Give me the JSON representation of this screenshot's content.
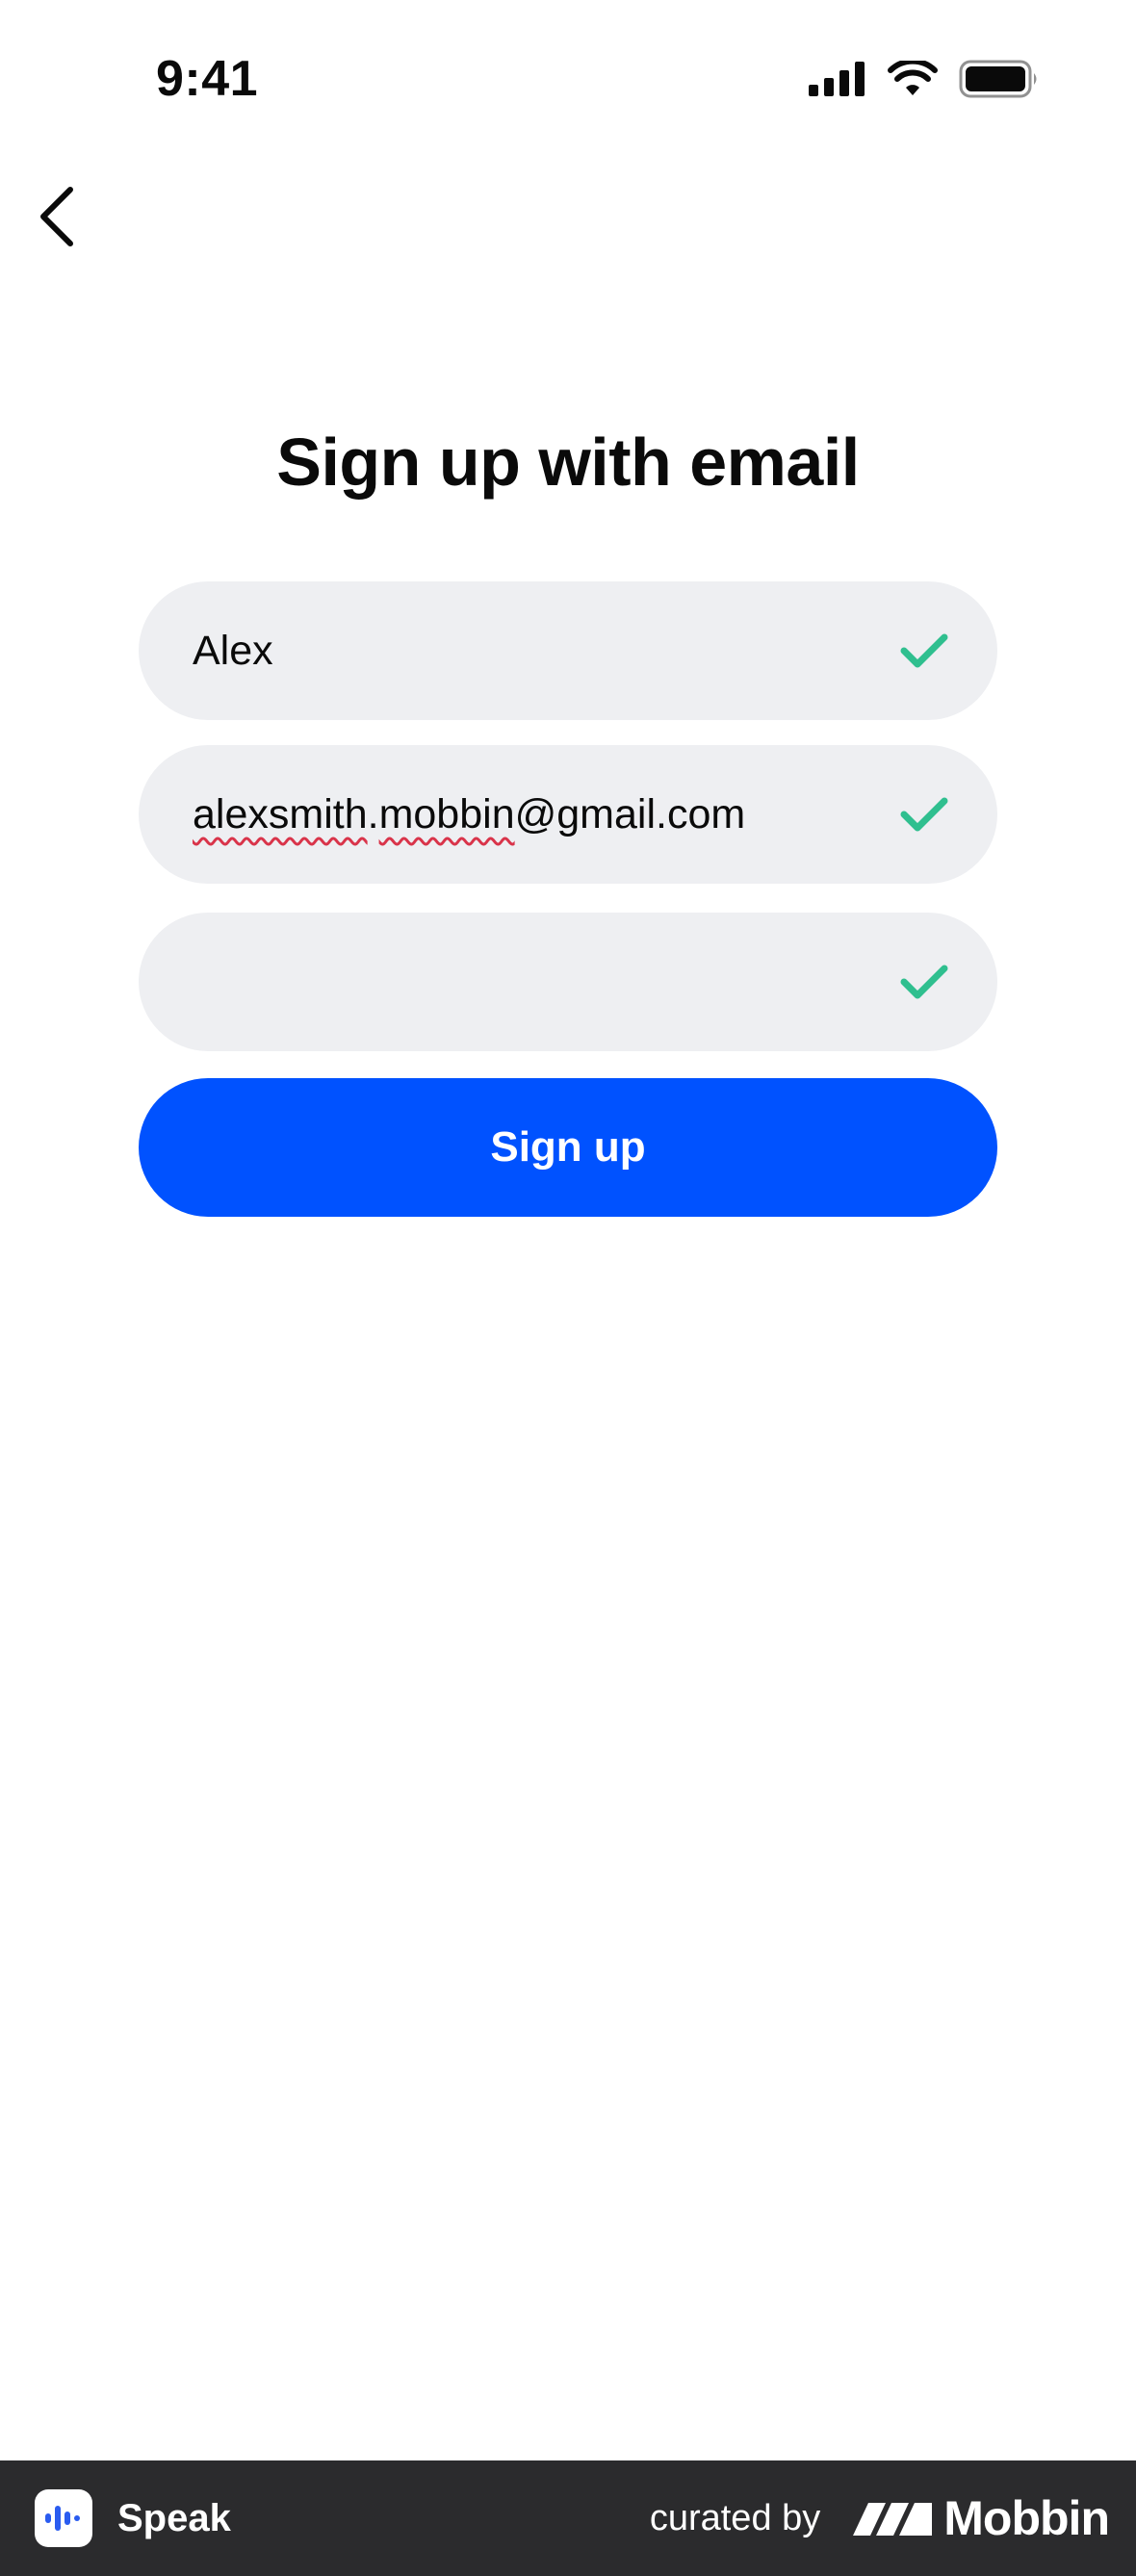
{
  "status_bar": {
    "time": "9:41",
    "icons": [
      "cellular-signal-icon",
      "wifi-icon",
      "battery-icon"
    ]
  },
  "nav": {
    "back_icon": "chevron-left-icon"
  },
  "page": {
    "title": "Sign up with email"
  },
  "form": {
    "name": {
      "value": "Alex",
      "valid": true
    },
    "email": {
      "value": "alexsmith.mobbin@gmail.com",
      "parts": [
        "alexsmith",
        ".",
        "mobbin",
        "@gmail.com"
      ],
      "valid": true
    },
    "password": {
      "value": "",
      "valid": true
    },
    "submit_label": "Sign up"
  },
  "footer": {
    "app_name": "Speak",
    "curated_by": "curated by",
    "brand": "Mobbin"
  },
  "colors": {
    "primary": "#0052ff",
    "field_bg": "#eeeff2",
    "check": "#2fbf8f",
    "footer_bg": "#2b2b2d"
  }
}
